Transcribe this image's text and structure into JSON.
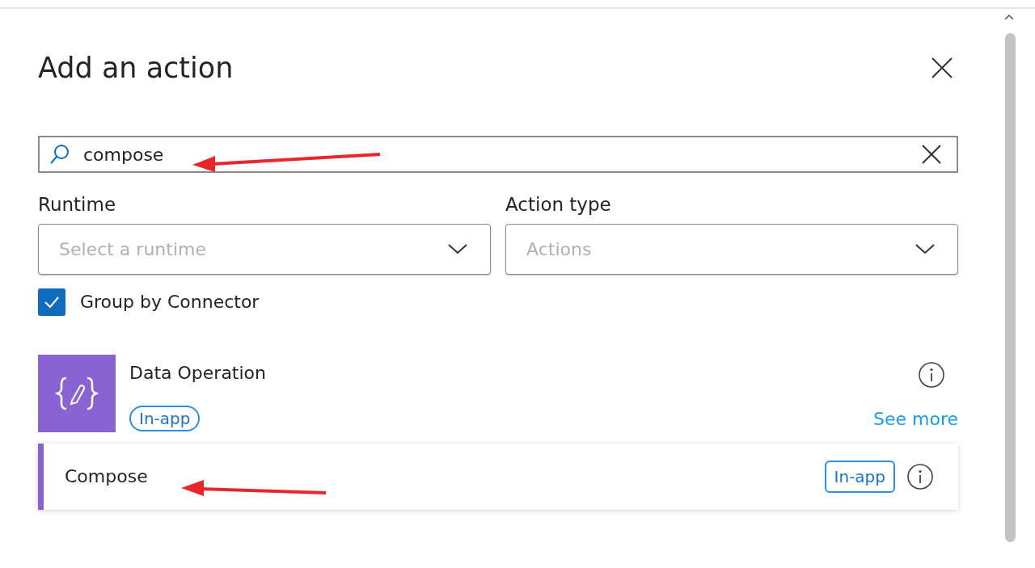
{
  "panel": {
    "title": "Add an action"
  },
  "search": {
    "value": "compose"
  },
  "filters": [
    {
      "label": "Runtime",
      "placeholder": "Select a runtime"
    },
    {
      "label": "Action type",
      "placeholder": "Actions"
    }
  ],
  "group_by_connector": {
    "label": "Group by Connector",
    "checked": true
  },
  "connectors": [
    {
      "name": "Data Operation",
      "badge": "In-app",
      "see_more": "See more",
      "actions": [
        {
          "name": "Compose",
          "badge": "In-app"
        }
      ]
    }
  ]
}
